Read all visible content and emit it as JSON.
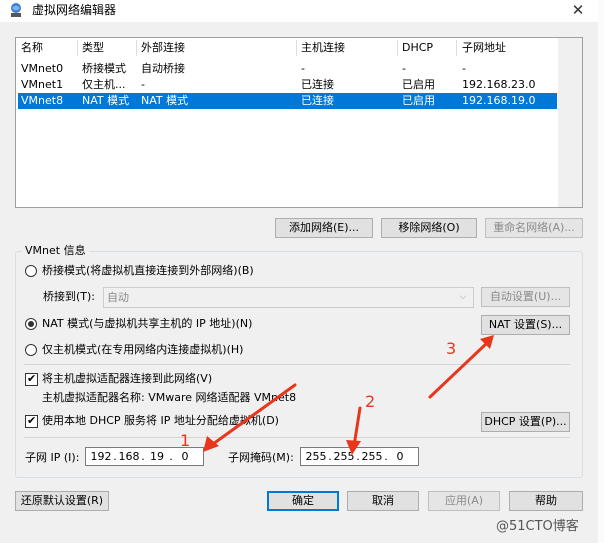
{
  "window": {
    "title": "虚拟网络编辑器",
    "close_glyph": "✕"
  },
  "list": {
    "columns": [
      "名称",
      "类型",
      "外部连接",
      "主机连接",
      "DHCP",
      "子网地址"
    ],
    "rows": [
      [
        "VMnet0",
        "桥接模式",
        "自动桥接",
        "-",
        "-",
        "-"
      ],
      [
        "VMnet1",
        "仅主机...",
        "-",
        "已连接",
        "已启用",
        "192.168.23.0"
      ],
      [
        "VMnet8",
        "NAT 模式",
        "NAT 模式",
        "已连接",
        "已启用",
        "192.168.19.0"
      ]
    ],
    "selected_row": 2
  },
  "buttons": {
    "add_network": "添加网络(E)...",
    "remove_network": "移除网络(O)",
    "rename_network": "重命名网络(A)...",
    "auto_settings": "自动设置(U)...",
    "nat_settings": "NAT 设置(S)...",
    "dhcp_settings": "DHCP 设置(P)...",
    "restore_defaults": "还原默认设置(R)",
    "ok": "确定",
    "cancel": "取消",
    "apply": "应用(A)",
    "help": "帮助"
  },
  "vmnet_info": {
    "group_label": "VMnet 信息",
    "bridged_label": "桥接模式(将虚拟机直接连接到外部网络)(B)",
    "bridged_to_label": "桥接到(T):",
    "bridged_to_value": "自动",
    "nat_label": "NAT 模式(与虚拟机共享主机的 IP 地址)(N)",
    "host_only_label": "仅主机模式(在专用网络内连接虚拟机)(H)",
    "selected_mode": "nat",
    "connect_adapter_label": "将主机虚拟适配器连接到此网络(V)",
    "connect_adapter_checked": true,
    "adapter_name_label": "主机虚拟适配器名称: VMware 网络适配器 VMnet8",
    "use_dhcp_label": "使用本地 DHCP 服务将 IP 地址分配给虚拟机(D)",
    "use_dhcp_checked": true,
    "subnet_ip_label": "子网 IP (I):",
    "subnet_ip": [
      "192",
      "168",
      "19",
      "0"
    ],
    "subnet_mask_label": "子网掩码(M):",
    "subnet_mask": [
      "255",
      "255",
      "255",
      "0"
    ]
  },
  "annotations": {
    "one": "1",
    "two": "2",
    "three": "3",
    "color": "#e8361c"
  },
  "watermark": "@51CTO博客"
}
